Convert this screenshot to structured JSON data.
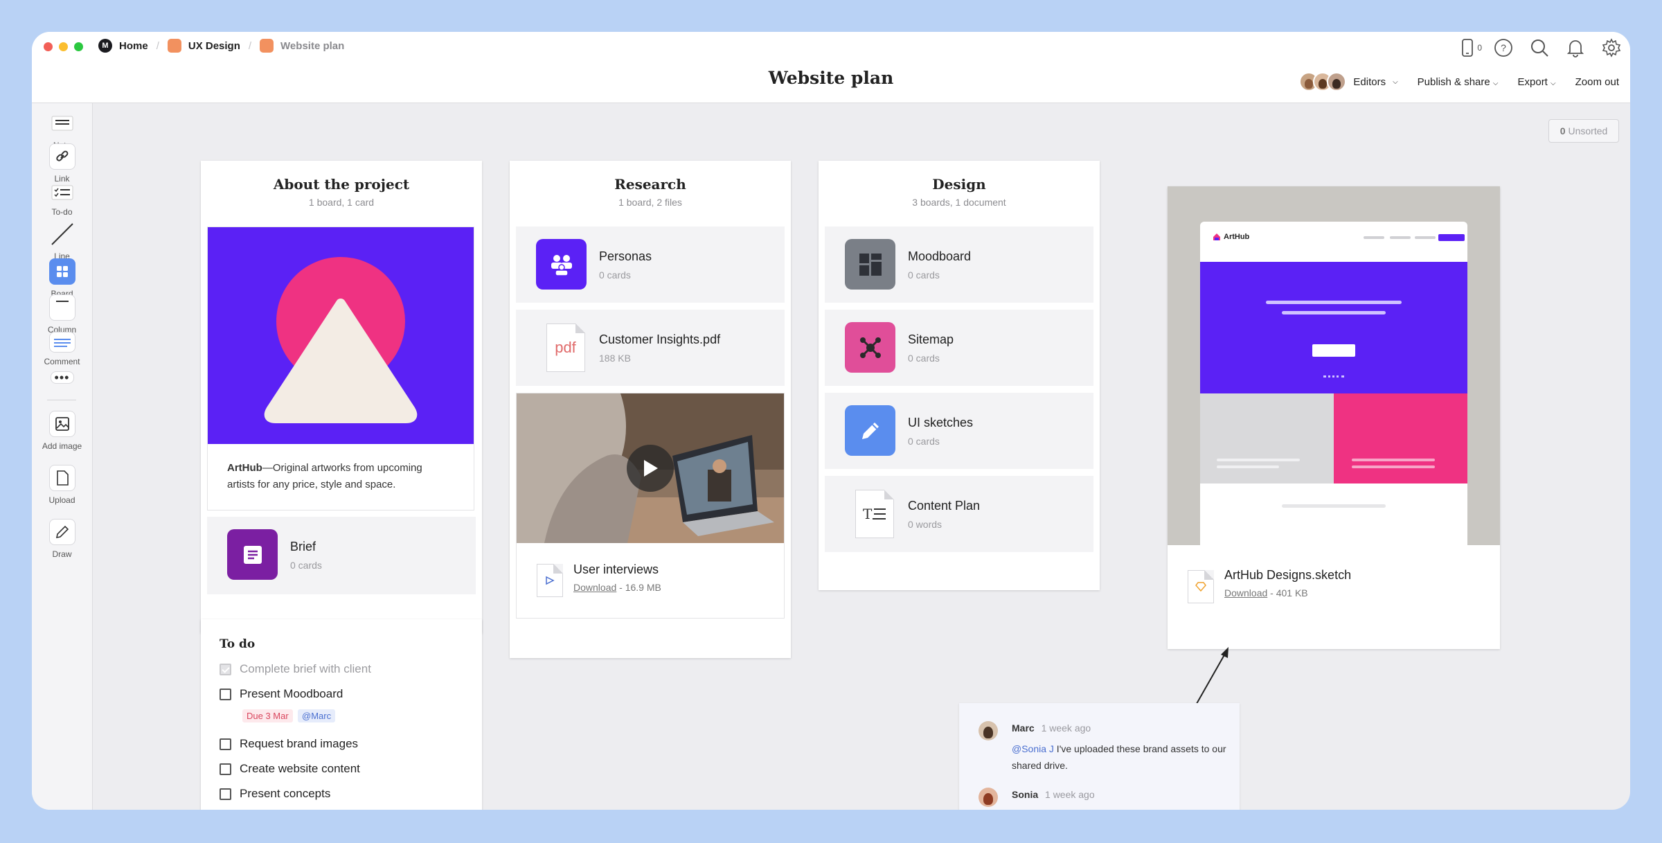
{
  "breadcrumb": [
    {
      "label": "Home",
      "icon": "home-icon"
    },
    {
      "label": "UX Design",
      "icon": "board-icon"
    },
    {
      "label": "Website plan",
      "icon": "board-icon"
    }
  ],
  "title": "Website plan",
  "device_count": "0",
  "menu": {
    "editors": "Editors",
    "publish": "Publish & share",
    "export": "Export",
    "zoom": "Zoom out"
  },
  "sidebar": {
    "tools": [
      {
        "label": "Note",
        "icon": "note-icon"
      },
      {
        "label": "Link",
        "icon": "link-icon"
      },
      {
        "label": "To-do",
        "icon": "todo-icon"
      },
      {
        "label": "Line",
        "icon": "line-icon"
      },
      {
        "label": "Board",
        "icon": "board-icon"
      },
      {
        "label": "Column",
        "icon": "column-icon"
      },
      {
        "label": "Comment",
        "icon": "comment-icon"
      },
      {
        "label": "",
        "icon": "more-icon"
      },
      {
        "label": "Add image",
        "icon": "image-icon"
      },
      {
        "label": "Upload",
        "icon": "upload-icon"
      },
      {
        "label": "Draw",
        "icon": "pencil-icon"
      }
    ]
  },
  "unsorted": {
    "count": "0",
    "label": "Unsorted"
  },
  "about": {
    "title": "About the project",
    "subtitle": "1 board, 1 card",
    "desc_bold": "ArtHub",
    "desc": "—Original artworks from upcoming artists for any price, style and space.",
    "brief": {
      "name": "Brief",
      "meta": "0 cards"
    }
  },
  "todo": {
    "title": "To do",
    "items": [
      {
        "label": "Complete brief with client",
        "done": true
      },
      {
        "label": "Present Moodboard",
        "done": false
      },
      {
        "label": "Request brand images",
        "done": false
      },
      {
        "label": "Create website content",
        "done": false
      },
      {
        "label": "Present concepts",
        "done": false
      }
    ],
    "due_tag": "Due 3 Mar",
    "mention_tag": "@Marc"
  },
  "research": {
    "title": "Research",
    "subtitle": "1 board, 2 files",
    "personas": {
      "name": "Personas",
      "meta": "0 cards"
    },
    "pdf": {
      "name": "Customer Insights.pdf",
      "meta": "188 KB",
      "ext": "pdf"
    },
    "video": {
      "name": "User interviews",
      "download": "Download",
      "size": "- 16.9 MB"
    }
  },
  "design": {
    "title": "Design",
    "subtitle": "3 boards, 1 document",
    "items": [
      {
        "name": "Moodboard",
        "meta": "0 cards"
      },
      {
        "name": "Sitemap",
        "meta": "0 cards"
      },
      {
        "name": "UI sketches",
        "meta": "0 cards"
      },
      {
        "name": "Content Plan",
        "meta": "0 words"
      }
    ]
  },
  "sketch": {
    "name": "ArtHub Designs.sketch",
    "download": "Download",
    "size": "- 401 KB",
    "brand": "ArtHub"
  },
  "comments": [
    {
      "author": "Marc",
      "time": "1 week ago",
      "mention": "@Sonia J",
      "text": " I've uploaded these brand assets to our shared drive."
    },
    {
      "author": "Sonia",
      "time": "1 week ago"
    }
  ],
  "colors": {
    "accent": "#5b21f5",
    "pink": "#ef3282",
    "purple": "#7b1fa2",
    "blue": "#5a8dee"
  }
}
